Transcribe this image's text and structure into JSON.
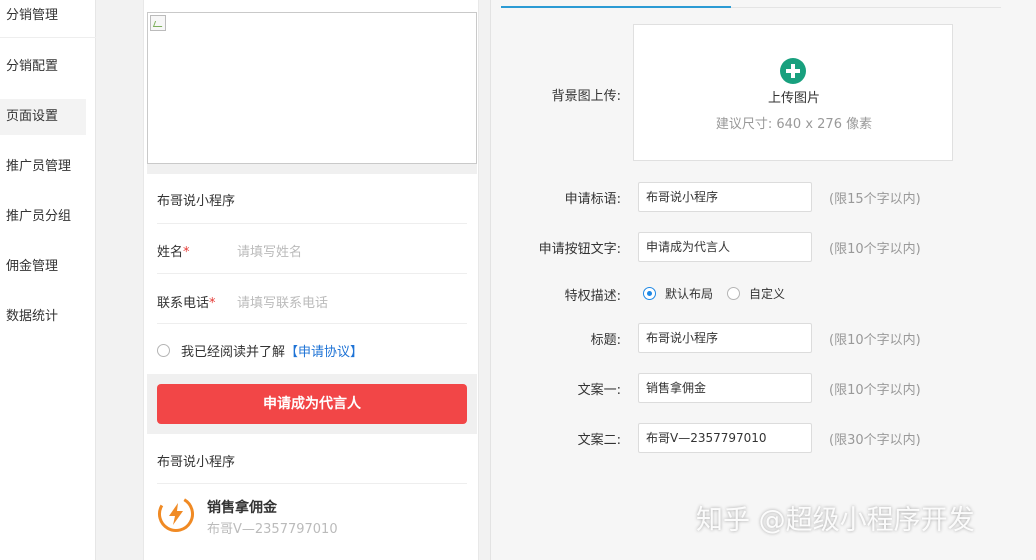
{
  "sidebar": {
    "header": "分销管理",
    "items": [
      {
        "label": "分销配置"
      },
      {
        "label": "页面设置"
      },
      {
        "label": "推广员管理"
      },
      {
        "label": "推广员分组"
      },
      {
        "label": "佣金管理"
      },
      {
        "label": "数据统计"
      }
    ],
    "active_index": 1
  },
  "preview": {
    "title": "布哥说小程序",
    "fields": [
      {
        "label": "姓名",
        "required": "*",
        "placeholder": "请填写姓名"
      },
      {
        "label": "联系电话",
        "required": "*",
        "placeholder": "请填写联系电话"
      }
    ],
    "agreement_text": "我已经阅读并了解",
    "agreement_link": "【申请协议】",
    "apply_button": "申请成为代言人",
    "privilege_title": "布哥说小程序",
    "privilege": {
      "title": "销售拿佣金",
      "subtitle": "布哥V—2357797010"
    }
  },
  "config": {
    "upload": {
      "label": "背景图上传:",
      "button": "上传图片",
      "hint": "建议尺寸: 640 x 276 像素"
    },
    "apply_title": {
      "label": "申请标语:",
      "value": "布哥说小程序",
      "hint": "(限15个字以内)"
    },
    "apply_button_text": {
      "label": "申请按钮文字:",
      "value": "申请成为代言人",
      "hint": "(限10个字以内)"
    },
    "privilege_desc": {
      "label": "特权描述:",
      "options": [
        "默认布局",
        "自定义"
      ],
      "selected": "默认布局"
    },
    "title": {
      "label": "标题:",
      "value": "布哥说小程序",
      "hint": "(限10个字以内)"
    },
    "copy1": {
      "label": "文案一:",
      "value": "销售拿佣金",
      "hint": "(限10个字以内)"
    },
    "copy2": {
      "label": "文案二:",
      "value": "布哥V—2357797010",
      "hint": "(限30个字以内)"
    }
  },
  "watermark": "知乎 @超级小程序开发",
  "colors": {
    "accent": "#1e88e5",
    "apply_button": "#f24647",
    "upload_plus": "#18a07e",
    "tab_active": "#2b9bd4"
  }
}
